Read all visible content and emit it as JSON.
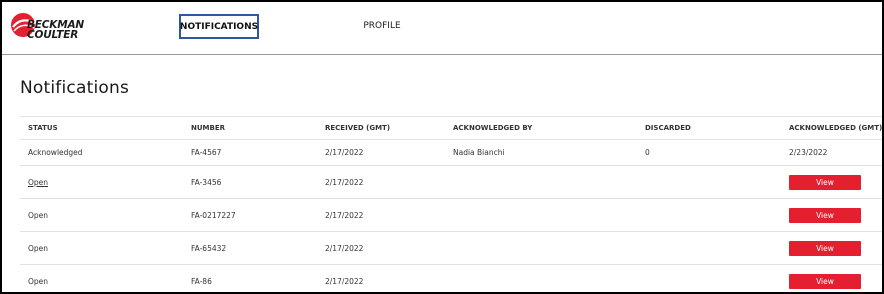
{
  "brand": {
    "logo_line1": "BECKMAN",
    "logo_line2": "COULTER",
    "accent_color": "#e41f2f"
  },
  "nav": {
    "items": [
      {
        "label": "NOTIFICATIONS",
        "active": true
      },
      {
        "label": "PROFILE",
        "active": false
      }
    ]
  },
  "page": {
    "title": "Notifications"
  },
  "table": {
    "columns": [
      "STATUS",
      "NUMBER",
      "RECEIVED (GMT)",
      "ACKNOWLEDGED BY",
      "DISCARDED",
      "ACKNOWLEDGED (GMT)"
    ],
    "rows": [
      {
        "status": "Acknowledged",
        "number": "FA-4567",
        "received": "2/17/2022",
        "acknowledged_by": "Nadia Bianchi",
        "discarded": "0",
        "acknowledged": "2/23/2022",
        "action": ""
      },
      {
        "status": "Open",
        "number": "FA-3456",
        "received": "2/17/2022",
        "acknowledged_by": "",
        "discarded": "",
        "acknowledged": "",
        "action": "View"
      },
      {
        "status": "Open",
        "number": "FA-0217227",
        "received": "2/17/2022",
        "acknowledged_by": "",
        "discarded": "",
        "acknowledged": "",
        "action": "View"
      },
      {
        "status": "Open",
        "number": "FA-65432",
        "received": "2/17/2022",
        "acknowledged_by": "",
        "discarded": "",
        "acknowledged": "",
        "action": "View"
      },
      {
        "status": "Open",
        "number": "FA-86",
        "received": "2/17/2022",
        "acknowledged_by": "",
        "discarded": "",
        "acknowledged": "",
        "action": "View"
      }
    ]
  }
}
